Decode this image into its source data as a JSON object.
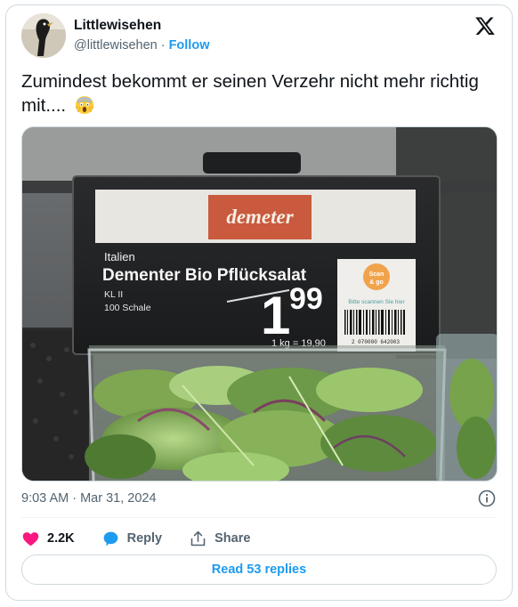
{
  "author": {
    "name": "Littlewisehen",
    "handle": "@littlewisehen",
    "separator": "·",
    "follow_label": "Follow"
  },
  "tweet": {
    "text": "Zumindest bekommt er seinen Verzehr nicht mehr richtig mit....",
    "emoji": "face-screaming-in-fear"
  },
  "media": {
    "price_tag": {
      "brand_logo": "demeter",
      "origin": "Italien",
      "product_name": "Dementer Bio Pflücksalat",
      "class": "KL II",
      "quantity": "100 Schale",
      "price_main": "1",
      "price_cents": "99",
      "unit_price": "1 kg = 19,90",
      "scan_badge_line1": "Scan",
      "scan_badge_line2": "& go",
      "scan_hint": "Bitte scannen Sie hier",
      "barcode_number": "2 070000 642003"
    }
  },
  "meta": {
    "timestamp": "9:03 AM · Mar 31, 2024"
  },
  "actions": {
    "like_count": "2.2K",
    "reply_label": "Reply",
    "share_label": "Share",
    "read_replies_label": "Read 53 replies"
  },
  "colors": {
    "accent": "#1d9bf0",
    "like": "#f91880",
    "text_secondary": "#536471",
    "border": "#cfd9de"
  }
}
